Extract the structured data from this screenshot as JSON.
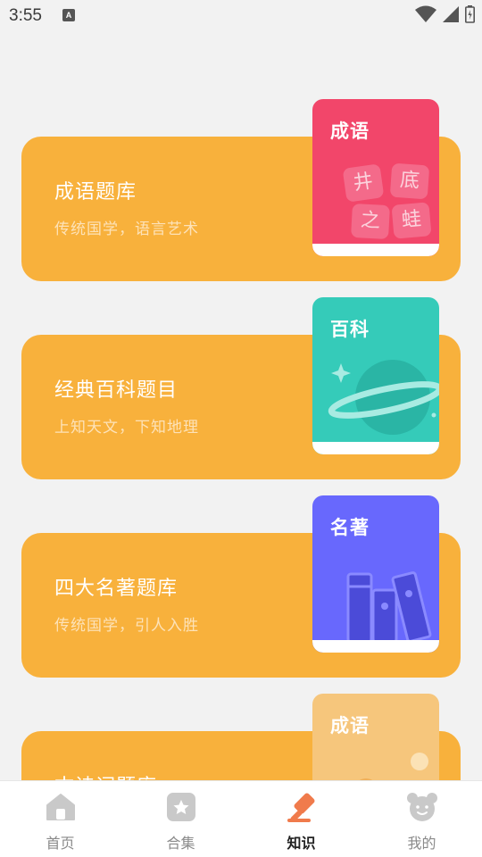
{
  "status_bar": {
    "time": "3:55",
    "notification_icon": "A"
  },
  "cards": [
    {
      "title": "成语题库",
      "subtitle": "传统国学，语言艺术",
      "book_label": "成语",
      "book_color": "#f2466a",
      "tiles": [
        "井",
        "底",
        "之",
        "蛙"
      ]
    },
    {
      "title": "经典百科题目",
      "subtitle": "上知天文，下知地理",
      "book_label": "百科",
      "book_color": "#35cbb9"
    },
    {
      "title": "四大名著题库",
      "subtitle": "传统国学，引人入胜",
      "book_label": "名著",
      "book_color": "#6868fd"
    },
    {
      "title": "古诗词题库",
      "subtitle": "",
      "book_label": "成语",
      "book_color": "#f6c67c"
    }
  ],
  "tabbar": {
    "tabs": [
      {
        "label": "首页",
        "icon": "home-icon"
      },
      {
        "label": "合集",
        "icon": "star-box-icon"
      },
      {
        "label": "知识",
        "icon": "gavel-icon",
        "active": true
      },
      {
        "label": "我的",
        "icon": "bear-face-icon"
      }
    ]
  },
  "colors": {
    "card": "#f8b13c",
    "background": "#f2f2f2",
    "active_icon": "#f07b4c",
    "inactive_icon": "#c9c9c9"
  }
}
